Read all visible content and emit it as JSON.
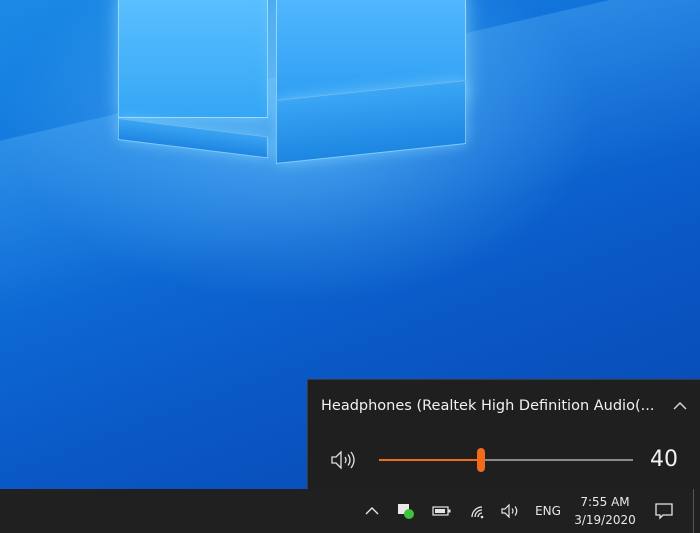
{
  "flyout": {
    "device_name": "Headphones (Realtek High Definition Audio(...",
    "volume_value": "40",
    "volume_fraction": 0.4,
    "accent_color": "#f26a1b"
  },
  "taskbar": {
    "language": "ENG",
    "time": "7:55 AM",
    "date": "3/19/2020",
    "icons": [
      "chevron-up-icon",
      "app-tray-icon",
      "battery-icon",
      "wifi-icon",
      "speaker-icon",
      "notification-icon"
    ]
  }
}
